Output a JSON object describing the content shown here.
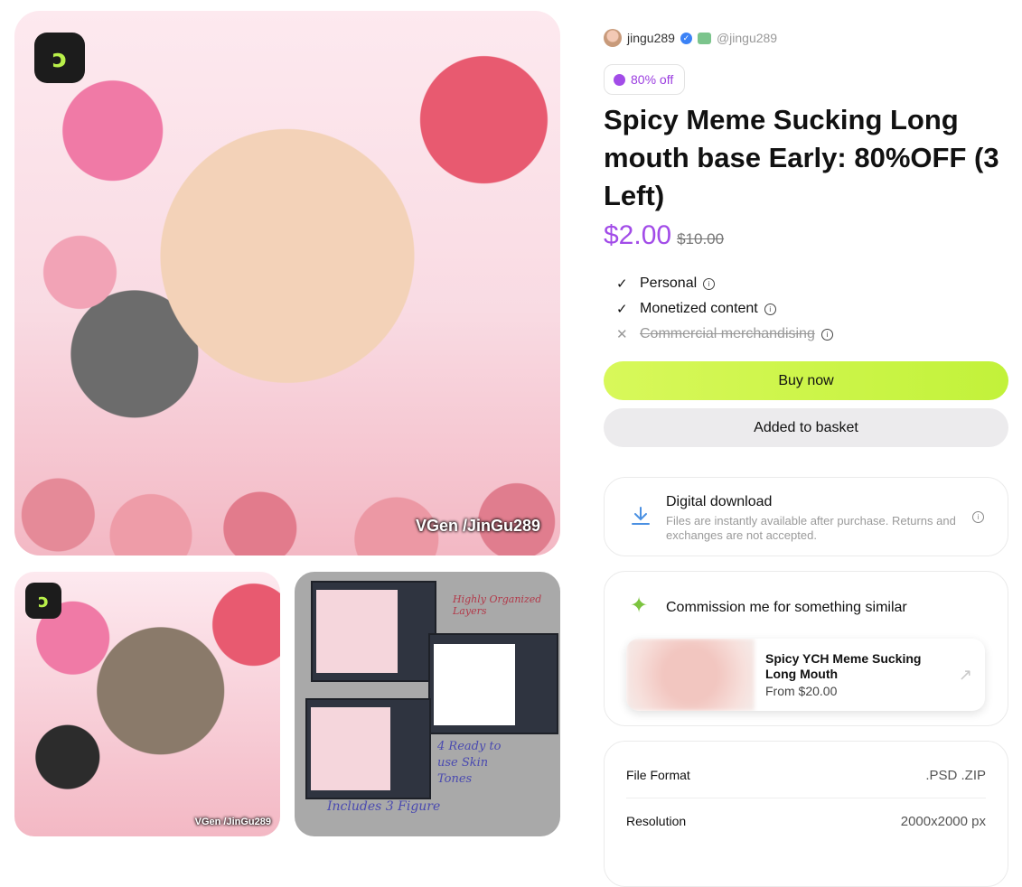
{
  "author": {
    "name": "jingu289",
    "handle": "@jingu289"
  },
  "discount_badge": "80% off",
  "title": "Spicy Meme Sucking Long mouth base Early: 80%OFF (3 Left)",
  "price": {
    "current": "$2.00",
    "original": "$10.00"
  },
  "licenses": [
    {
      "label": "Personal",
      "included": true
    },
    {
      "label": "Monetized content",
      "included": true
    },
    {
      "label": "Commercial merchandising",
      "included": false
    }
  ],
  "buttons": {
    "buy": "Buy now",
    "basket": "Added to basket"
  },
  "digital_download": {
    "title": "Digital download",
    "description": "Files are instantly available after purchase. Returns and exchanges are not accepted."
  },
  "commission": {
    "title": "Commission me for something similar",
    "offer_title": "Spicy YCH Meme Sucking Long Mouth",
    "offer_price": "From $20.00"
  },
  "specs": [
    {
      "label": "File Format",
      "value": ".PSD .ZIP"
    },
    {
      "label": "Resolution",
      "value": "2000x2000 px"
    }
  ],
  "gallery": {
    "main_watermark": "VGen /JinGu289",
    "thumb_watermark": "VGen /JinGu289",
    "notes": [
      "Highly Organized Layers",
      "4 Ready to use Skin Tones",
      "Includes 3 Figure"
    ]
  },
  "colors": {
    "accent_purple": "#a24ce8",
    "buy_green": "#c8f54a",
    "basket_gray": "#ecebed"
  }
}
